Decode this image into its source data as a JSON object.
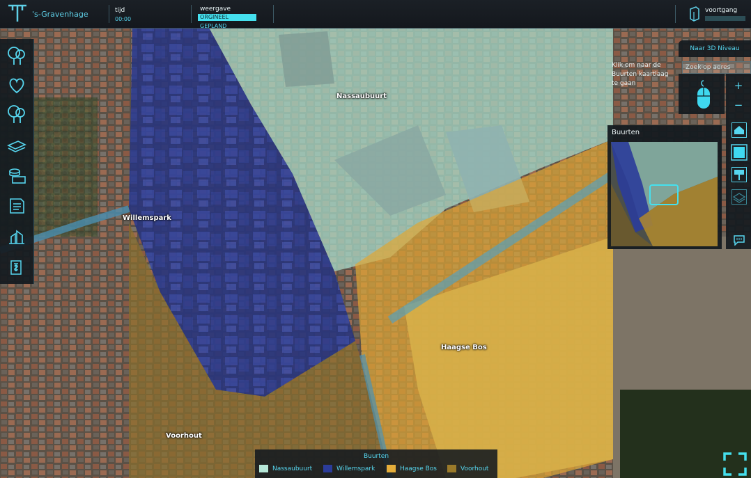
{
  "header": {
    "city": "'s-Gravenhage",
    "time_label": "tijd",
    "time_value": "00:00",
    "view_label": "weergave",
    "view_selected": "ORGINEEL",
    "view_other": "GEPLAND",
    "progress_label": "voortgang"
  },
  "left_toolbar": {
    "icons": [
      "trees-icon",
      "heart-icon",
      "trees-icon",
      "layers-money-icon",
      "coins-icon",
      "document-icon",
      "chart-icon",
      "wallet-icon"
    ]
  },
  "right_panel": {
    "button_3d": "Naar 3D Niveau",
    "search_placeholder": "Zoek op adres",
    "help_text": "Klik om naar de Buurten kaartlaag te gaan",
    "zoom_in": "+",
    "zoom_out": "−"
  },
  "buurten_window": {
    "title": "Buurten"
  },
  "map": {
    "labels": {
      "nassaubuurt": "Nassaubuurt",
      "willemspark": "Willemspark",
      "haagse_bos": "Haagse Bos",
      "voorhout": "Voorhout"
    }
  },
  "legend": {
    "title": "Buurten",
    "items": [
      {
        "label": "Nassaubuurt",
        "color": "#b6e8d8"
      },
      {
        "label": "Willemspark",
        "color": "#2b3c9a"
      },
      {
        "label": "Haagse Bos",
        "color": "#e6ae3a"
      },
      {
        "label": "Voorhout",
        "color": "#9a7a2a"
      }
    ]
  },
  "colors": {
    "accent": "#45e0ee",
    "panel": "#141a20"
  }
}
